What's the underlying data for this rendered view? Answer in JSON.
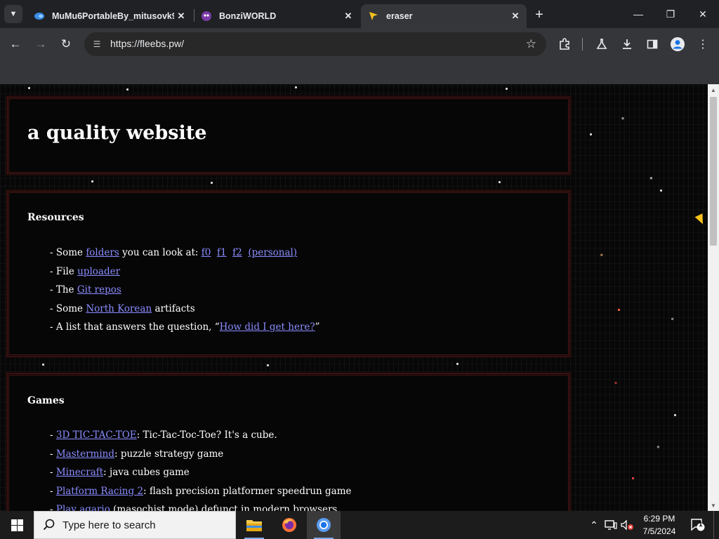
{
  "browser": {
    "tabs": [
      {
        "title": "MuMu6PortableBy_mitusovk9",
        "active": false
      },
      {
        "title": "BonziWORLD",
        "active": false
      },
      {
        "title": "eraser",
        "active": true
      }
    ],
    "url": "https://fleebs.pw/",
    "icons": [
      "tab-search-icon",
      "new-tab-icon",
      "back-icon",
      "forward-icon",
      "reload-icon",
      "site-info-icon",
      "bookmark-star-icon",
      "extensions-icon",
      "labs-icon",
      "download-icon",
      "side-panel-icon",
      "profile-icon",
      "menu-icon"
    ]
  },
  "page": {
    "title": "a quality website",
    "resources": {
      "heading": "Resources",
      "items": [
        {
          "prefix": "- Some ",
          "link": "folders",
          "mid": " you can look at: ",
          "links": [
            "f0",
            "f1",
            "f2",
            "(personal)"
          ]
        },
        {
          "prefix": "- File ",
          "link": "uploader"
        },
        {
          "prefix": "- The ",
          "link": "Git repos"
        },
        {
          "prefix": "- Some ",
          "link": "North Korean",
          "suffix": " artifacts"
        },
        {
          "prefix": "- A list that answers the question, “",
          "link": "How did I get here?",
          "suffix": "”"
        }
      ]
    },
    "games": {
      "heading": "Games",
      "items": [
        {
          "prefix": "- ",
          "link": "3D TIC-TAC-TOE",
          "suffix": ": Tic-Tac-Toc-Toe? It's a cube."
        },
        {
          "prefix": "- ",
          "link": "Mastermind",
          "suffix": ": puzzle strategy game"
        },
        {
          "prefix": "- ",
          "link": "Minecraft",
          "suffix": ": java cubes game"
        },
        {
          "prefix": "- ",
          "link": "Platform Racing 2",
          "suffix": ": flash precision platformer speedrun game"
        },
        {
          "prefix": "- ",
          "link": "Play agario",
          "suffix": " (masochist mode) defunct in modern browsers"
        }
      ]
    }
  },
  "taskbar": {
    "search_placeholder": "Type here to search",
    "apps": [
      "file-explorer",
      "firefox",
      "chrome"
    ],
    "time": "6:29 PM",
    "date": "7/5/2024",
    "notification_count": "1"
  },
  "colors": {
    "link": "#8a8cff",
    "box_border": "#4a1515",
    "page_bg": "#070707",
    "chrome_dark": "#202124",
    "chrome_toolbar": "#35363a"
  }
}
